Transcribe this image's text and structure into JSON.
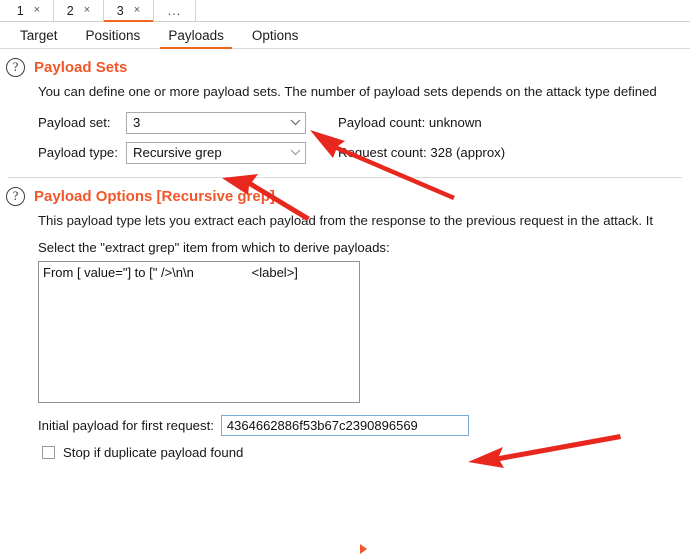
{
  "attack_tabs": [
    {
      "label": "1",
      "close": "×",
      "active": false
    },
    {
      "label": "2",
      "close": "×",
      "active": false
    },
    {
      "label": "3",
      "close": "×",
      "active": true
    },
    {
      "label": "...",
      "close": "",
      "active": false
    }
  ],
  "section_tabs": [
    {
      "label": "Target",
      "active": false
    },
    {
      "label": "Positions",
      "active": false
    },
    {
      "label": "Payloads",
      "active": true
    },
    {
      "label": "Options",
      "active": false
    }
  ],
  "payload_sets": {
    "help_icon": "?",
    "title": "Payload Sets",
    "description": "You can define one or more payload sets. The number of payload sets depends on the attack type defined",
    "payload_set_label": "Payload set:",
    "payload_set_value": "3",
    "payload_type_label": "Payload type:",
    "payload_type_value": "Recursive grep",
    "payload_count": "Payload count:  unknown",
    "request_count": "Request count:  328 (approx)",
    "chevron_icon": "chevron-down-icon"
  },
  "payload_options": {
    "help_icon": "?",
    "title": "Payload Options [Recursive grep]",
    "description": "This payload type lets you extract each payload from the response to the previous request in the attack. It",
    "grep_label": "Select the \"extract grep\" item from which to derive payloads:",
    "grep_items": [
      "From [ value=\"] to [\" />\\n\\n                <label>]"
    ],
    "initial_payload_label": "Initial payload for first request:",
    "initial_payload_value": "4364662886f53b67c2390896569",
    "stop_duplicate_label": "Stop if duplicate payload found",
    "stop_duplicate_checked": false
  },
  "colors": {
    "accent": "#f2572a",
    "annotation": "#e8281e",
    "text": "#1a1a1a",
    "border": "#ababab"
  }
}
